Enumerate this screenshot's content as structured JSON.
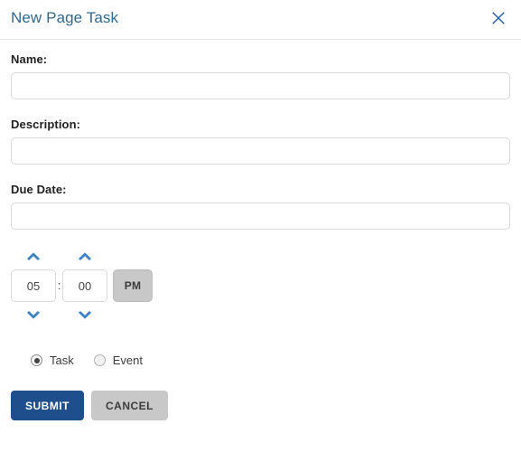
{
  "dialog": {
    "title": "New Page Task",
    "close_icon": "close-x-icon",
    "accent_color": "#31688e",
    "submit_color": "#1f4e8c",
    "neutral_color": "#c8c8c8",
    "chevron_color": "#3f82c4"
  },
  "fields": {
    "name": {
      "label": "Name:",
      "value": "",
      "placeholder": ""
    },
    "description": {
      "label": "Description:",
      "value": "",
      "placeholder": ""
    },
    "due_date": {
      "label": "Due Date:",
      "value": "",
      "placeholder": ""
    }
  },
  "time_picker": {
    "hour": "05",
    "separator": ":",
    "minute": "00",
    "meridiem": "PM",
    "hour_up_icon": "chevron-up-icon",
    "hour_down_icon": "chevron-down-icon",
    "minute_up_icon": "chevron-up-icon",
    "minute_down_icon": "chevron-down-icon"
  },
  "type_options": [
    {
      "label": "Task",
      "selected": true
    },
    {
      "label": "Event",
      "selected": false
    }
  ],
  "actions": {
    "submit_label": "SUBMIT",
    "cancel_label": "CANCEL"
  }
}
